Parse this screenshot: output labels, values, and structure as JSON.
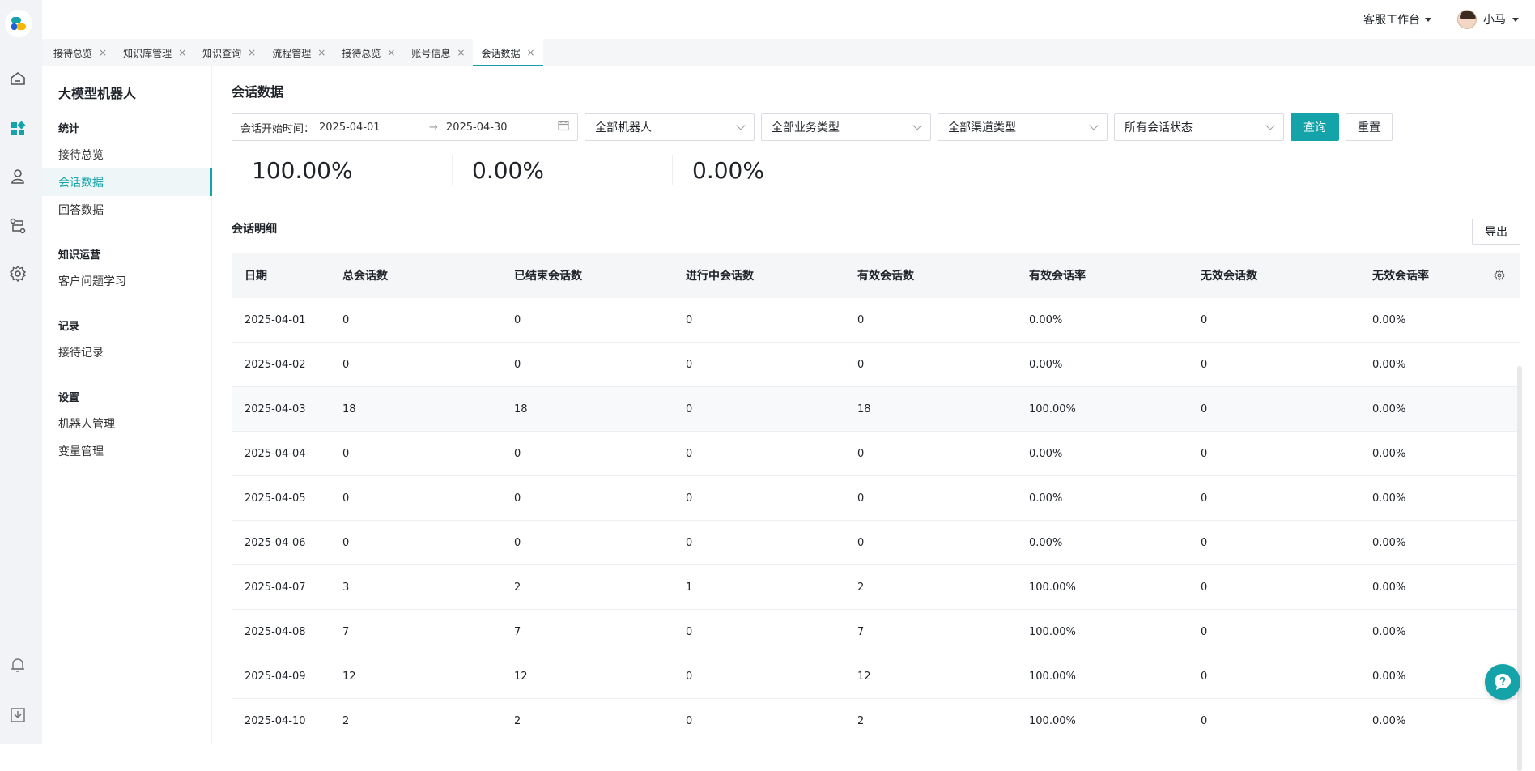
{
  "header": {
    "workspace": "客服工作台",
    "user_name": "小马"
  },
  "tabs": [
    {
      "label": "接待总览"
    },
    {
      "label": "知识库管理"
    },
    {
      "label": "知识查询"
    },
    {
      "label": "流程管理"
    },
    {
      "label": "接待总览"
    },
    {
      "label": "账号信息"
    },
    {
      "label": "会话数据"
    }
  ],
  "tab_close_glyph": "×",
  "subnav": {
    "title": "大模型机器人",
    "groups": [
      {
        "label": "统计",
        "items": [
          "接待总览",
          "会话数据",
          "回答数据"
        ]
      },
      {
        "label": "知识运营",
        "items": [
          "客户问题学习"
        ]
      },
      {
        "label": "记录",
        "items": [
          "接待记录"
        ]
      },
      {
        "label": "设置",
        "items": [
          "机器人管理",
          "变量管理"
        ]
      }
    ]
  },
  "main": {
    "page_title": "会话数据",
    "filters": {
      "date_label": "会话开始时间：",
      "start_date": "2025-04-01",
      "arrow": "→",
      "end_date": "2025-04-30",
      "robot": "全部机器人",
      "business": "全部业务类型",
      "channel": "全部渠道类型",
      "status": "所有会话状态",
      "query_label": "查询",
      "reset_label": "重置"
    },
    "stats": [
      "100.00%",
      "0.00%",
      "0.00%"
    ],
    "detail_title": "会话明细",
    "export_label": "导出",
    "table": {
      "columns": [
        "日期",
        "总会话数",
        "已结束会话数",
        "进行中会话数",
        "有效会话数",
        "有效会话率",
        "无效会话数",
        "无效会话率"
      ],
      "rows": [
        [
          "2025-04-01",
          "0",
          "0",
          "0",
          "0",
          "0.00%",
          "0",
          "0.00%"
        ],
        [
          "2025-04-02",
          "0",
          "0",
          "0",
          "0",
          "0.00%",
          "0",
          "0.00%"
        ],
        [
          "2025-04-03",
          "18",
          "18",
          "0",
          "18",
          "100.00%",
          "0",
          "0.00%"
        ],
        [
          "2025-04-04",
          "0",
          "0",
          "0",
          "0",
          "0.00%",
          "0",
          "0.00%"
        ],
        [
          "2025-04-05",
          "0",
          "0",
          "0",
          "0",
          "0.00%",
          "0",
          "0.00%"
        ],
        [
          "2025-04-06",
          "0",
          "0",
          "0",
          "0",
          "0.00%",
          "0",
          "0.00%"
        ],
        [
          "2025-04-07",
          "3",
          "2",
          "1",
          "2",
          "100.00%",
          "0",
          "0.00%"
        ],
        [
          "2025-04-08",
          "7",
          "7",
          "0",
          "7",
          "100.00%",
          "0",
          "0.00%"
        ],
        [
          "2025-04-09",
          "12",
          "12",
          "0",
          "12",
          "100.00%",
          "0",
          "0.00%"
        ],
        [
          "2025-04-10",
          "2",
          "2",
          "0",
          "2",
          "100.00%",
          "0",
          "0.00%"
        ]
      ]
    }
  },
  "colors": {
    "accent": "#14a3a8",
    "rail_bg": "#f1f3f6",
    "header_row_bg": "#f5f6f8"
  }
}
